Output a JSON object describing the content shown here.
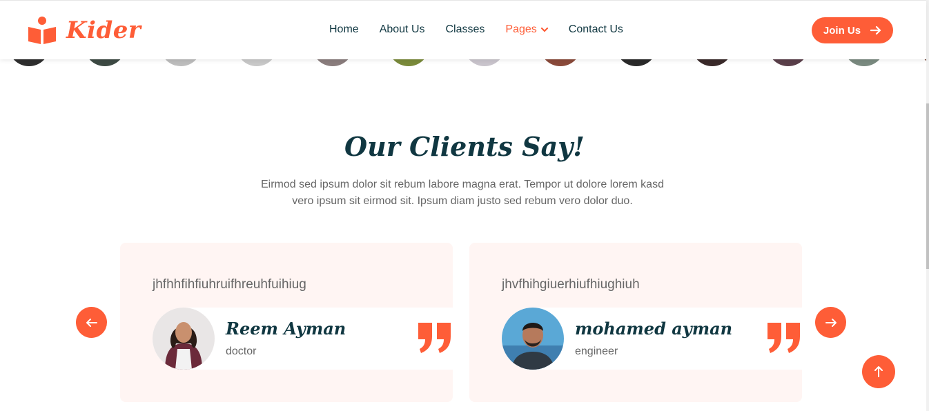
{
  "brand": {
    "name": "Kider"
  },
  "nav": {
    "items": [
      {
        "label": "Home",
        "active": false
      },
      {
        "label": "About Us",
        "active": false
      },
      {
        "label": "Classes",
        "active": false
      },
      {
        "label": "Pages",
        "active": true,
        "has_dropdown": true
      },
      {
        "label": "Contact Us",
        "active": false
      }
    ],
    "cta_label": "Join Us"
  },
  "section": {
    "title": "Our Clients Say!",
    "subtitle": "Eirmod sed ipsum dolor sit rebum labore magna erat. Tempor ut dolore lorem kasd vero ipsum sit eirmod sit. Ipsum diam justo sed rebum vero dolor duo."
  },
  "testimonials": [
    {
      "text": "jhfhhfihfiuhruifhreuhfuihiug",
      "name": "Reem Ayman",
      "role": "doctor"
    },
    {
      "text": "jhvfhihgiuerhiufhiughiuh",
      "name": "mohamed ayman",
      "role": "engineer"
    }
  ],
  "colors": {
    "accent": "#FE5D37",
    "dark": "#103741",
    "card_bg": "#FFF5F3",
    "muted": "#666666"
  },
  "icons": {
    "logo": "book-reader-icon",
    "join": "arrow-right-icon",
    "prev": "arrow-left-icon",
    "next": "arrow-right-icon",
    "quote": "quote-right-icon",
    "top": "arrow-up-icon"
  }
}
